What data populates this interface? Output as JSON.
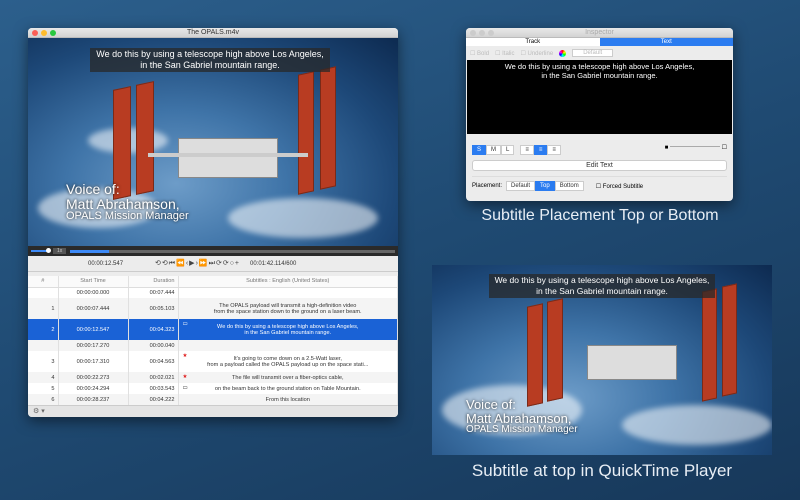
{
  "main_window": {
    "title": "The OPALS.m4v",
    "subtitle_lines": [
      "We do this by using a telescope high above Los Angeles,",
      "in the San Gabriel mountain range."
    ],
    "voice": {
      "line1": "Voice of:",
      "line2": "Matt Abrahamson,",
      "line3": "OPALS Mission Manager"
    },
    "speed": "1x",
    "progress": 0.12,
    "current_time": "00:00:12.547",
    "total_time": "00:01:42.114/600",
    "columns": [
      "#",
      "Start Time",
      "Duration",
      "Subtitles : English (United States)"
    ],
    "rows": [
      {
        "num": "",
        "start": "00:00:00.000",
        "dur": "00:07.444",
        "text1": "",
        "text2": "",
        "mark": ""
      },
      {
        "num": "1",
        "start": "00:00:07.444",
        "dur": "00:05.103",
        "text1": "The OPALS payload will transmit a high-definition video",
        "text2": "from the space station down to the ground on a laser beam.",
        "mark": ""
      },
      {
        "num": "2",
        "start": "00:00:12.547",
        "dur": "00:04.323",
        "text1": "We do this by using a telescope high above Los Angeles,",
        "text2": "in the San Gabriel mountain range.",
        "mark": "window"
      },
      {
        "num": "",
        "start": "00:00:17.270",
        "dur": "00:00.040",
        "text1": "",
        "text2": "",
        "mark": ""
      },
      {
        "num": "3",
        "start": "00:00:17.310",
        "dur": "00:04.563",
        "text1": "It's going to come down on a 2.5-Watt laser,",
        "text2": "from a payload called the OPALS payload up on the space stati...",
        "mark": "star"
      },
      {
        "num": "4",
        "start": "00:00:22.273",
        "dur": "00:02.021",
        "text1": "The file will transmit over a fiber-optics cable,",
        "text2": "",
        "mark": "star"
      },
      {
        "num": "5",
        "start": "00:00:24.294",
        "dur": "00:03.543",
        "text1": "on the beam back to the ground station on Table Mountain.",
        "text2": "",
        "mark": "window"
      },
      {
        "num": "6",
        "start": "00:00:28.237",
        "dur": "00:04.222",
        "text1": "From this location",
        "text2": "",
        "mark": ""
      }
    ]
  },
  "inspector": {
    "title": "Inspector",
    "tabs": [
      "Track",
      "Text"
    ],
    "active_tab": "Text",
    "bold": "Bold",
    "italic": "Italic",
    "underline": "Underline",
    "default_btn": "Default",
    "preview_lines": [
      "We do this by using a telescope high above Los Angeles,",
      "in the San Gabriel mountain range."
    ],
    "sizes": [
      "S",
      "M",
      "L"
    ],
    "edit_text": "Edit Text",
    "placement_label": "Placement:",
    "placements": [
      "Default",
      "Top",
      "Bottom"
    ],
    "active_placement": "Top",
    "forced": "Forced Subtitle"
  },
  "caption1": "Subtitle Placement Top or Bottom",
  "caption2": "Subtitle at top in QuickTime Player",
  "qt": {
    "subtitle_lines": [
      "We do this by using a telescope high above Los Angeles,",
      "in the San Gabriel mountain range."
    ],
    "voice": {
      "line1": "Voice of:",
      "line2": "Matt Abrahamson,",
      "line3": "OPALS Mission Manager"
    }
  },
  "colors": {
    "selection": "#1a62d6",
    "accent": "#2b7cf0",
    "star": "#e02020"
  }
}
